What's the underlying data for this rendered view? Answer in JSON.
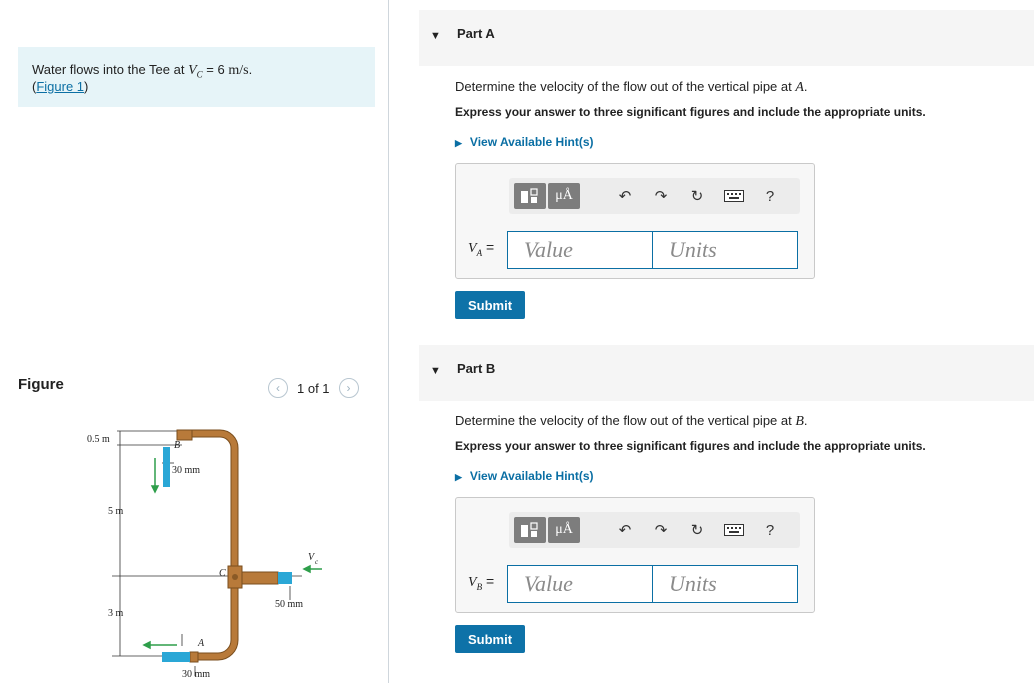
{
  "problem": {
    "intro": "Water flows into the Tee at ",
    "vc_symbol": "V",
    "vc_sub": "C",
    "eq": " = 6 ",
    "unit": "m/s",
    "period": ".",
    "figure_link": "Figure 1",
    "paren_open": "(",
    "paren_close": ")"
  },
  "figure_panel": {
    "title": "Figure",
    "pager_text": "1 of 1",
    "prev_icon": "chevron-left",
    "next_icon": "chevron-right",
    "labels": {
      "top_dim": "0.5 m",
      "B": "B",
      "d_b": "30 mm",
      "h1": "5 m",
      "C": "C",
      "vc": "V",
      "vc_sub": "c",
      "d_c": "50 mm",
      "h2": "3 m",
      "A": "A",
      "d_a": "30 mm"
    },
    "colors": {
      "pipe": "#b87a3a",
      "water": "#2aa7d6",
      "arrow": "#2e9e4a"
    }
  },
  "parts": [
    {
      "label": "Part A",
      "question": "Determine the velocity of the flow out of the vertical pipe at ",
      "point": "A",
      "period": ".",
      "instruction": "Express your answer to three significant figures and include the appropriate units.",
      "hint": "View Available Hint(s)",
      "var": "V",
      "var_sub": "A",
      "eq": " =",
      "value_placeholder": "Value",
      "units_placeholder": "Units",
      "submit": "Submit"
    },
    {
      "label": "Part B",
      "question": "Determine the velocity of the flow out of the vertical pipe at ",
      "point": "B",
      "period": ".",
      "instruction": "Express your answer to three significant figures and include the appropriate units.",
      "hint": "View Available Hint(s)",
      "var": "V",
      "var_sub": "B",
      "eq": " =",
      "value_placeholder": "Value",
      "units_placeholder": "Units",
      "submit": "Submit"
    }
  ],
  "toolbar": {
    "templates_icon": "templates-icon",
    "mu_label": "μÅ",
    "undo_icon": "undo-icon",
    "redo_icon": "redo-icon",
    "reset_icon": "reset-icon",
    "keyboard_icon": "keyboard-icon",
    "help_label": "?"
  },
  "colors": {
    "accent": "#0b6fa4",
    "prompt_bg": "#e6f4f8",
    "submit_bg": "#0e72a8"
  }
}
